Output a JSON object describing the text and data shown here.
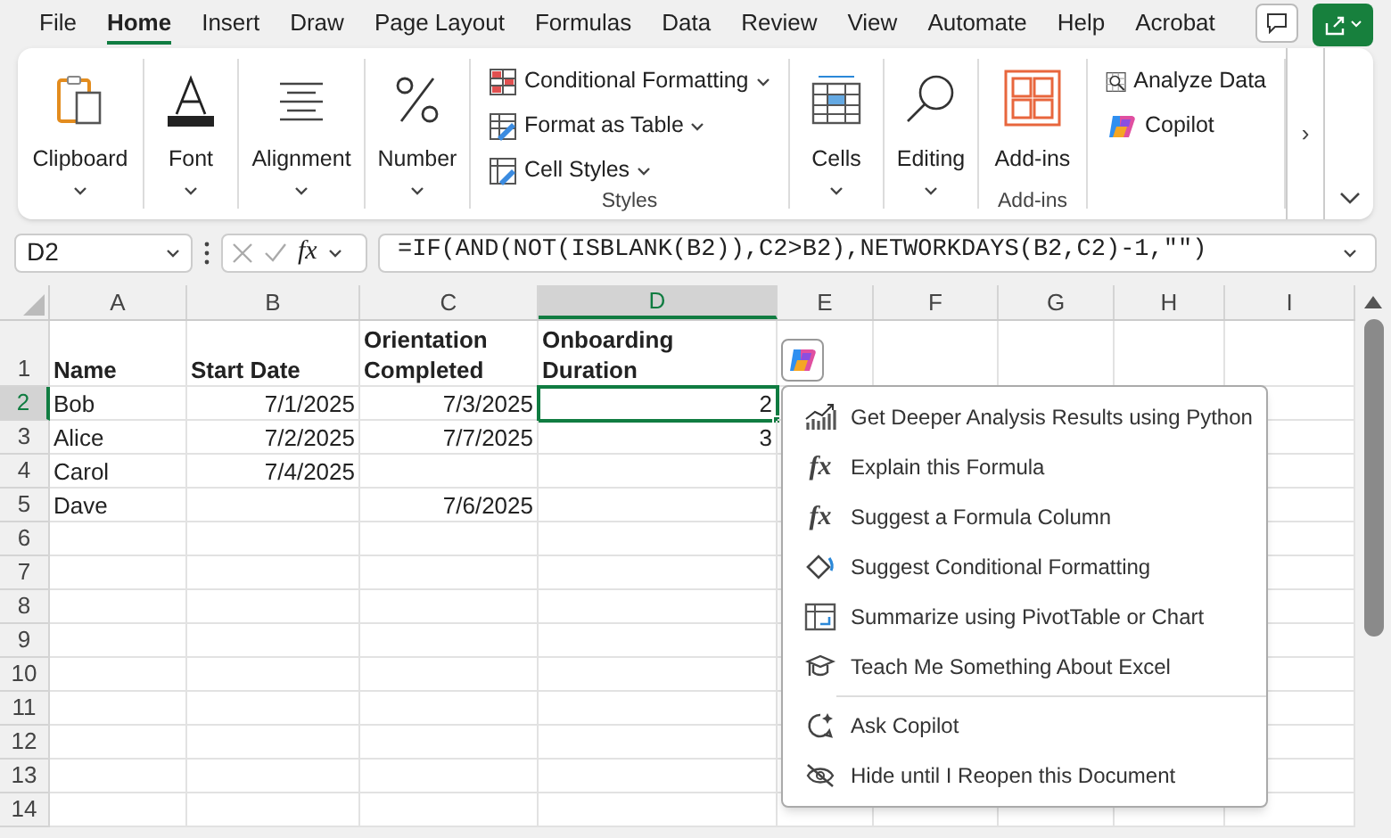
{
  "menu_tabs": [
    {
      "label": "File",
      "selected": false
    },
    {
      "label": "Home",
      "selected": true
    },
    {
      "label": "Insert",
      "selected": false
    },
    {
      "label": "Draw",
      "selected": false
    },
    {
      "label": "Page Layout",
      "selected": false
    },
    {
      "label": "Formulas",
      "selected": false
    },
    {
      "label": "Data",
      "selected": false
    },
    {
      "label": "Review",
      "selected": false
    },
    {
      "label": "View",
      "selected": false
    },
    {
      "label": "Automate",
      "selected": false
    },
    {
      "label": "Help",
      "selected": false
    },
    {
      "label": "Acrobat",
      "selected": false
    }
  ],
  "ribbon": {
    "groups": [
      {
        "kind": "dropdown",
        "label": "Clipboard"
      },
      {
        "kind": "dropdown",
        "label": "Font"
      },
      {
        "kind": "dropdown",
        "label": "Alignment"
      },
      {
        "kind": "dropdown",
        "label": "Number"
      },
      {
        "kind": "list",
        "title": "Styles",
        "items": [
          {
            "label": "Conditional Formatting",
            "dropdown": true
          },
          {
            "label": "Format as Table",
            "dropdown": true
          },
          {
            "label": "Cell Styles",
            "dropdown": true
          }
        ]
      },
      {
        "kind": "dropdown",
        "label": "Cells"
      },
      {
        "kind": "dropdown",
        "label": "Editing"
      },
      {
        "kind": "button",
        "label": "Add-ins",
        "title": "Add-ins"
      },
      {
        "kind": "list",
        "items": [
          {
            "label": "Analyze Data",
            "dropdown": false
          },
          {
            "label": "Copilot",
            "dropdown": false
          }
        ]
      }
    ],
    "more": "›"
  },
  "formula_bar": {
    "name_box": "D2",
    "function_button": "fx",
    "formula": "=IF(AND(NOT(ISBLANK(B2)),C2>B2),NETWORKDAYS(B2,C2)-1,\"\")"
  },
  "sheet": {
    "columns": [
      {
        "label": "A",
        "selected": false
      },
      {
        "label": "B",
        "selected": false
      },
      {
        "label": "C",
        "selected": false
      },
      {
        "label": "D",
        "selected": true
      },
      {
        "label": "E",
        "selected": false
      },
      {
        "label": "F",
        "selected": false
      },
      {
        "label": "G",
        "selected": false
      },
      {
        "label": "H",
        "selected": false
      },
      {
        "label": "I",
        "selected": false
      }
    ],
    "rows": [
      {
        "header": "1",
        "kind": "header",
        "selected": false,
        "cells": [
          "Name",
          "Start Date",
          "Orientation Completed",
          "Onboarding Duration"
        ]
      },
      {
        "header": "2",
        "kind": "data",
        "selected": true,
        "cells": [
          "Bob",
          "7/1/2025",
          "7/3/2025",
          "2"
        ]
      },
      {
        "header": "3",
        "kind": "data",
        "selected": false,
        "cells": [
          "Alice",
          "7/2/2025",
          "7/7/2025",
          "3"
        ]
      },
      {
        "header": "4",
        "kind": "data",
        "selected": false,
        "cells": [
          "Carol",
          "7/4/2025"
        ]
      },
      {
        "header": "5",
        "kind": "data",
        "selected": false,
        "cells": [
          "Dave",
          null,
          "7/6/2025"
        ]
      },
      {
        "header": "6",
        "kind": "data",
        "selected": false
      },
      {
        "header": "7",
        "kind": "data",
        "selected": false
      },
      {
        "header": "8",
        "kind": "data",
        "selected": false
      },
      {
        "header": "9",
        "kind": "data",
        "selected": false
      },
      {
        "header": "10",
        "kind": "data",
        "selected": false
      },
      {
        "header": "11",
        "kind": "data",
        "selected": false
      },
      {
        "header": "12",
        "kind": "data",
        "selected": false
      },
      {
        "header": "13",
        "kind": "data",
        "selected": false
      },
      {
        "header": "14",
        "kind": "data",
        "selected": false
      }
    ]
  },
  "copilot_menu": {
    "sections": [
      {
        "items": [
          {
            "label": "Get Deeper Analysis Results using Python"
          },
          {
            "label": "Explain this Formula",
            "glyph": "fx"
          },
          {
            "label": "Suggest a Formula Column",
            "glyph": "fx"
          },
          {
            "label": "Suggest Conditional Formatting"
          },
          {
            "label": "Summarize using PivotTable or Chart"
          },
          {
            "label": "Teach Me Something About Excel"
          }
        ]
      },
      {
        "items": [
          {
            "label": "Ask Copilot"
          },
          {
            "label": "Hide until I Reopen this Document"
          }
        ]
      }
    ]
  }
}
